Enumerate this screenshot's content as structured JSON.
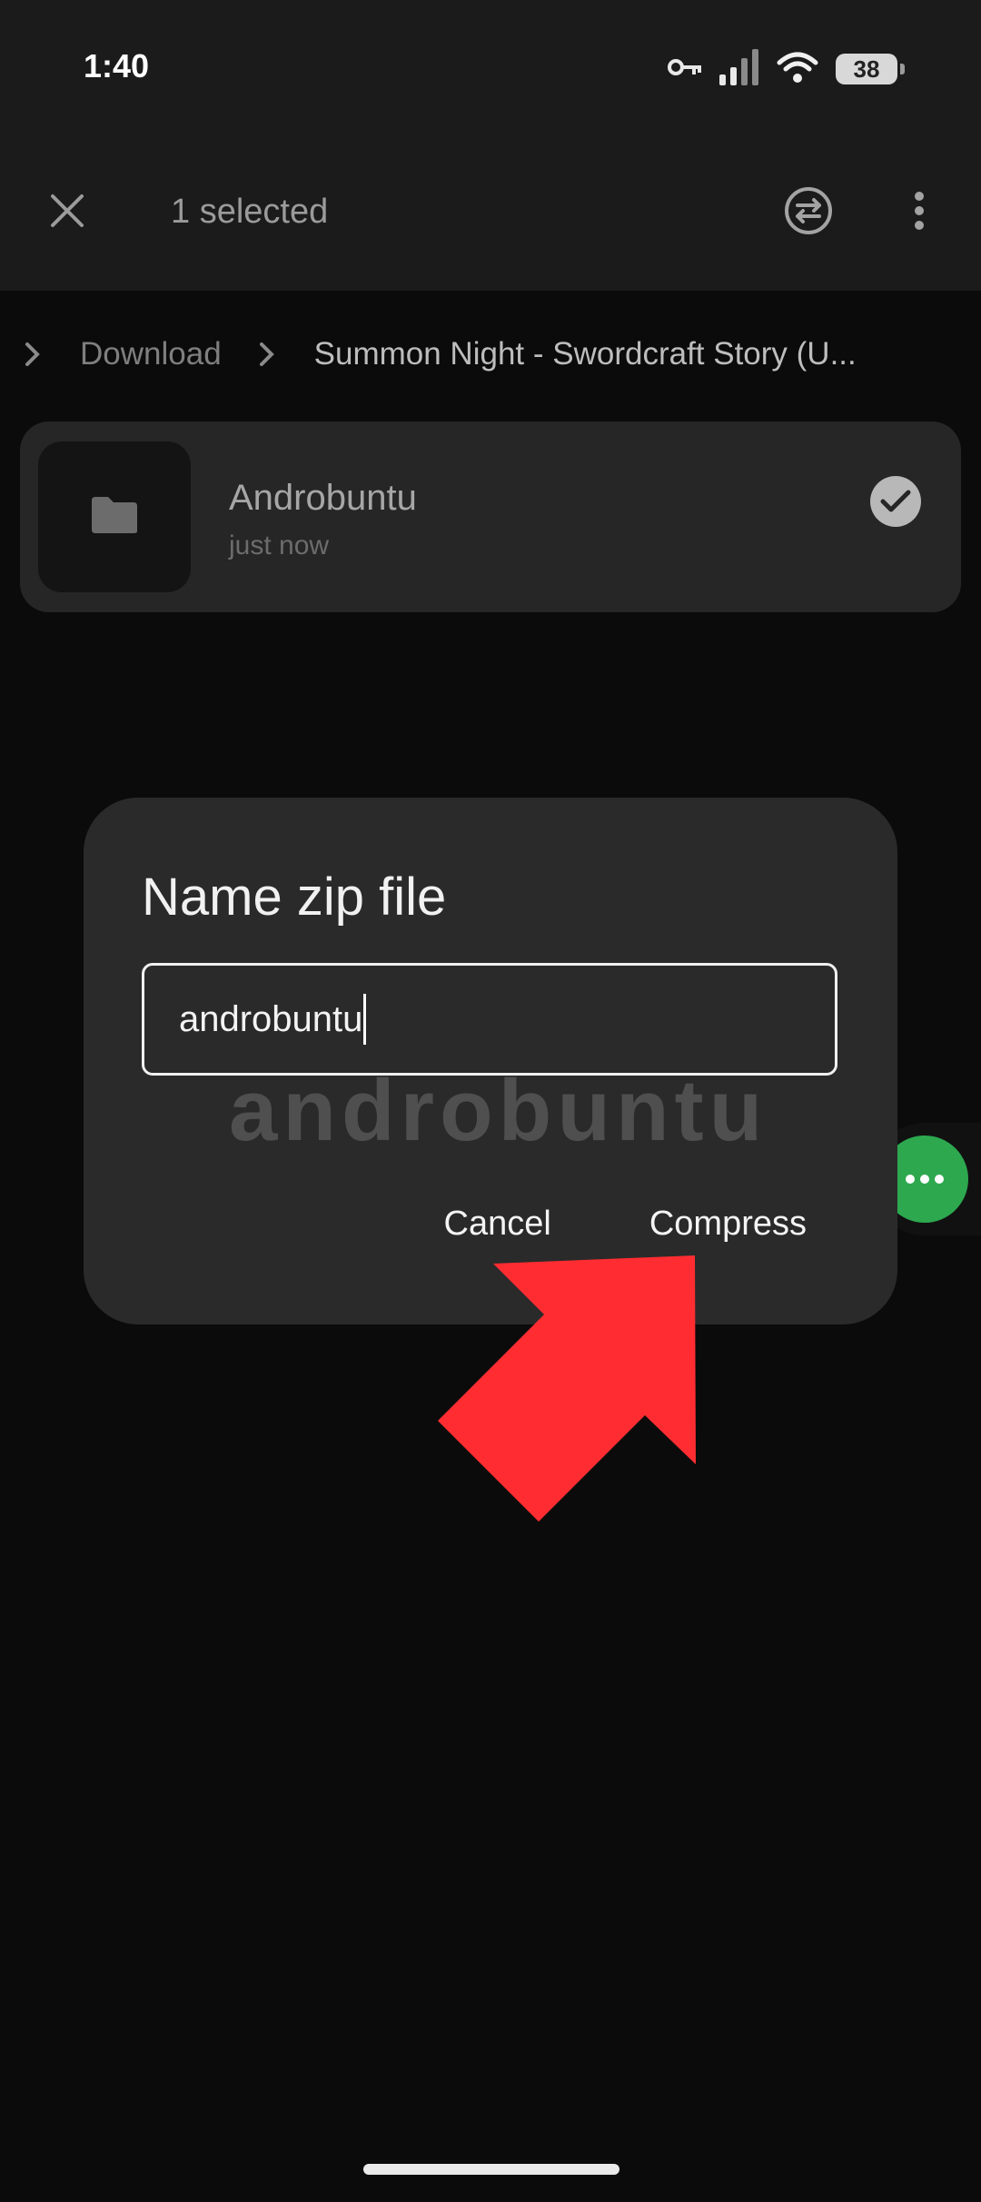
{
  "status_bar": {
    "time": "1:40",
    "battery": "38",
    "icons": [
      "vpn-key-icon",
      "cell-signal-icon",
      "wifi-icon",
      "battery-icon"
    ]
  },
  "toolbar": {
    "title": "1 selected",
    "close_icon": "close-icon",
    "sync_icon": "sync-icon",
    "more_icon": "more-vert-icon"
  },
  "breadcrumb": {
    "items": [
      "Download",
      "Summon Night - Swordcraft Story (U..."
    ]
  },
  "file": {
    "name": "Androbuntu",
    "meta": "just now",
    "selected": true
  },
  "dialog": {
    "title": "Name zip file",
    "input_value": "androbuntu",
    "cancel_label": "Cancel",
    "confirm_label": "Compress"
  },
  "watermark": "androbuntu",
  "colors": {
    "accent_green": "#2da84f",
    "annotation_red": "#ff2d31",
    "background": "#0c0c0c",
    "dialog": "#2a2a2a"
  }
}
